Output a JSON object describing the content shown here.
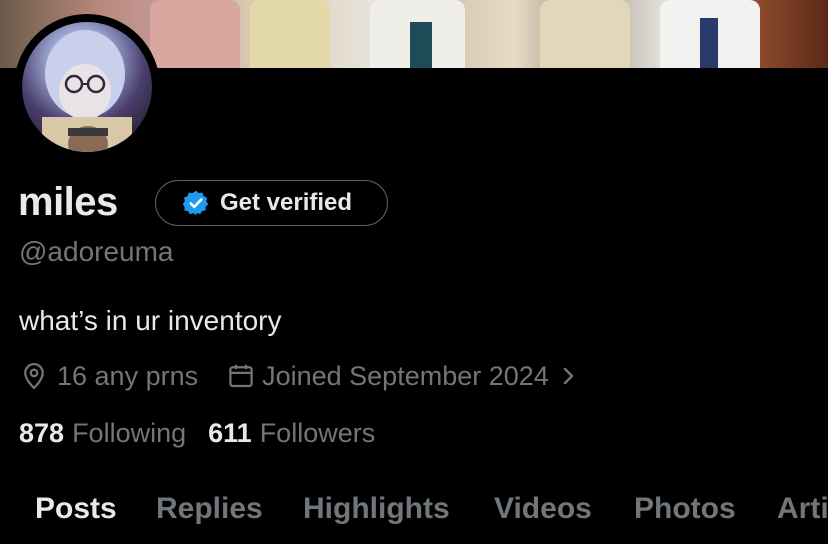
{
  "profile": {
    "display_name": "miles",
    "verify_button": "Get verified",
    "handle": "@adoreuma",
    "bio": "what’s in ur inventory",
    "location": "16 any prns",
    "joined": "Joined September 2024"
  },
  "stats": {
    "following_count": "878",
    "following_label": "Following",
    "followers_count": "611",
    "followers_label": "Followers"
  },
  "tabs": [
    "Posts",
    "Replies",
    "Highlights",
    "Videos",
    "Photos",
    "Arti"
  ],
  "colors": {
    "background": "#000000",
    "primary_text": "#e7e9ea",
    "secondary_text": "#71767b",
    "verified_blue": "#1d9bf0"
  },
  "icons": {
    "location": "location-pin-icon",
    "calendar": "calendar-icon",
    "chevron": "chevron-right-icon",
    "verified": "verified-badge-icon"
  }
}
